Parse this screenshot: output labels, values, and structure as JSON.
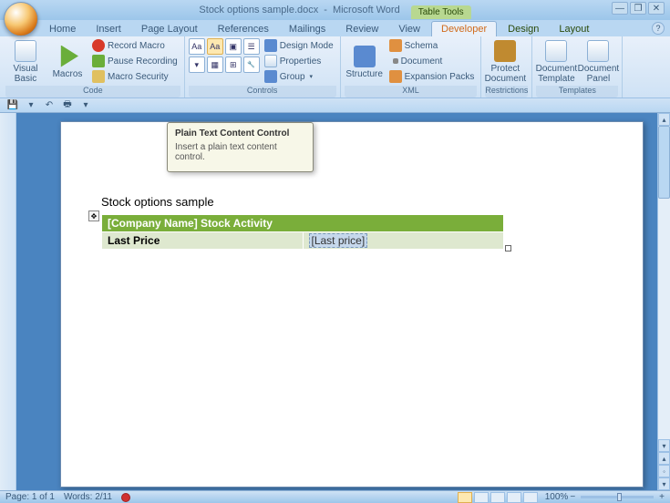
{
  "title": {
    "doc": "Stock options sample.docx",
    "app": "Microsoft Word",
    "context": "Table Tools"
  },
  "tabs": [
    "Home",
    "Insert",
    "Page Layout",
    "References",
    "Mailings",
    "Review",
    "View",
    "Developer",
    "Design",
    "Layout"
  ],
  "active_tab": "Developer",
  "ribbon": {
    "code": {
      "label": "Code",
      "visual_basic": "Visual Basic",
      "macros": "Macros",
      "record": "Record Macro",
      "pause": "Pause Recording",
      "security": "Macro Security"
    },
    "controls": {
      "label": "Controls",
      "design": "Design Mode",
      "properties": "Properties",
      "group": "Group"
    },
    "xml": {
      "label": "XML",
      "structure": "Structure",
      "schema": "Schema",
      "document": "Document",
      "expansion": "Expansion Packs"
    },
    "restrictions": {
      "label": "Restrictions",
      "protect": "Protect Document"
    },
    "templates": {
      "label": "Templates",
      "doc_template": "Document Template",
      "doc_panel": "Document Panel"
    }
  },
  "tooltip": {
    "title": "Plain Text Content Control",
    "body": "Insert a plain text content control."
  },
  "document": {
    "title": "Stock options sample",
    "table": {
      "header": "[Company Name] Stock Activity",
      "row_label": "Last Price",
      "row_value": "[Last price]"
    }
  },
  "status": {
    "page": "Page: 1 of 1",
    "words": "Words: 2/11",
    "zoom": "100%"
  }
}
